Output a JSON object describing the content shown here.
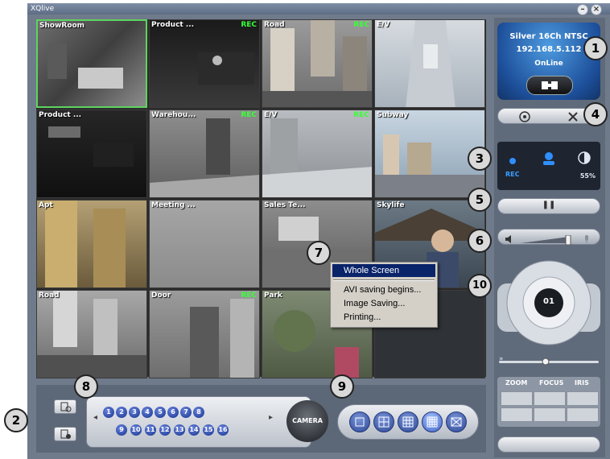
{
  "window": {
    "title": "XQlive",
    "minimize_glyph": "–",
    "close_glyph": "×"
  },
  "cameras": [
    {
      "name": "ShowRoom",
      "rec": "",
      "selected": true
    },
    {
      "name": "Product ...",
      "rec": "REC"
    },
    {
      "name": "Road",
      "rec": "REC"
    },
    {
      "name": "E/V",
      "rec": ""
    },
    {
      "name": "Product ...",
      "rec": ""
    },
    {
      "name": "Warehou...",
      "rec": "REC"
    },
    {
      "name": "E/V",
      "rec": "REC"
    },
    {
      "name": "Subway",
      "rec": ""
    },
    {
      "name": "Apt",
      "rec": ""
    },
    {
      "name": "Meeting ...",
      "rec": ""
    },
    {
      "name": "Sales Te...",
      "rec": ""
    },
    {
      "name": "Skylife",
      "rec": ""
    },
    {
      "name": "Road",
      "rec": ""
    },
    {
      "name": "Door",
      "rec": "REC"
    },
    {
      "name": "Park",
      "rec": ""
    },
    {
      "name": "",
      "rec": ""
    }
  ],
  "device": {
    "name": "Silver 16Ch NTSC",
    "ip": "192.168.5.112",
    "status": "OnLine"
  },
  "status_panel": {
    "rec_label": "REC",
    "percent": "55%"
  },
  "pause_glyph": "❚❚",
  "joystick_channel": "01",
  "ptz": {
    "zoom": "ZOOM",
    "focus": "FOCUS",
    "iris": "IRIS"
  },
  "channels": [
    "1",
    "2",
    "3",
    "4",
    "5",
    "6",
    "7",
    "8",
    "9",
    "10",
    "11",
    "12",
    "13",
    "14",
    "15",
    "16"
  ],
  "camera_button": "CAMERA",
  "context_menu": {
    "items": [
      "Whole Screen",
      "AVI saving begins...",
      "Image Saving...",
      "Printing..."
    ],
    "highlighted": "Whole Screen"
  },
  "callouts": [
    "1",
    "2",
    "3",
    "4",
    "5",
    "6",
    "7",
    "8",
    "9",
    "10"
  ],
  "colors": {
    "rec": "#38ff38",
    "selected_border": "#5fd35f",
    "menu_highlight": "#0a246a",
    "device_panel": "#1d4f9a"
  },
  "icons": [
    "minimize-icon",
    "close-icon",
    "connect-icon",
    "settings-wheel-icon",
    "tools-icon",
    "record-status-icon",
    "user-icon",
    "disk-usage-icon",
    "speaker-icon",
    "volume-slider-icon",
    "mic-icon",
    "ptz-joystick-icon",
    "layout-icon"
  ]
}
